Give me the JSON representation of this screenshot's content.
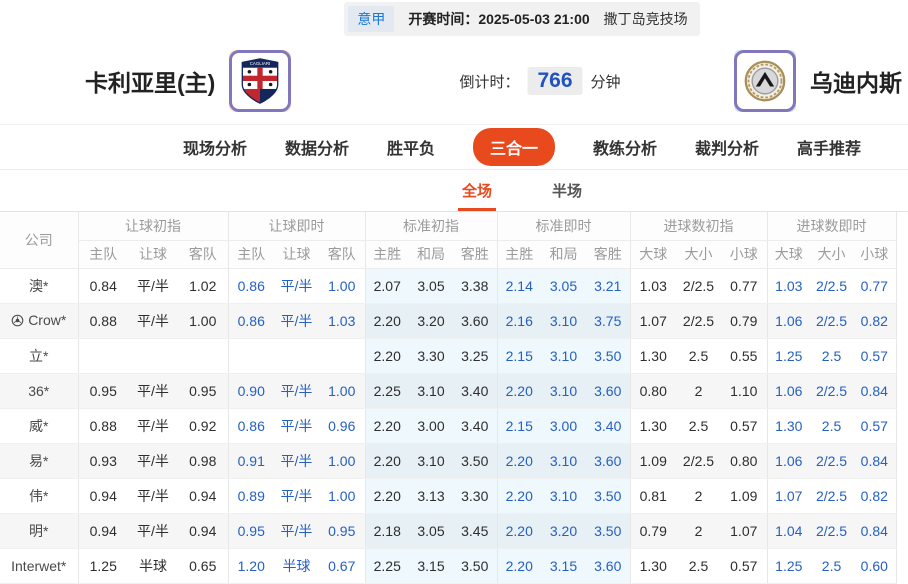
{
  "top_bar": {
    "league": "意甲",
    "kickoff_label": "开赛时间：",
    "kickoff_time": "2025-05-03 21:00",
    "venue": "撒丁岛竞技场"
  },
  "match_header": {
    "home_team": "卡利亚里(主)",
    "away_team": "乌迪内斯",
    "home_logo_icon": "cagliari-crest-icon",
    "away_logo_icon": "udinese-crest-icon",
    "countdown_label": "倒计时：",
    "countdown_value": "766",
    "countdown_unit": "分钟"
  },
  "nav": {
    "items": [
      {
        "label": "现场分析",
        "active": false
      },
      {
        "label": "数据分析",
        "active": false
      },
      {
        "label": "胜平负",
        "active": false
      },
      {
        "label": "三合一",
        "active": true
      },
      {
        "label": "教练分析",
        "active": false
      },
      {
        "label": "裁判分析",
        "active": false
      },
      {
        "label": "高手推荐",
        "active": false
      }
    ]
  },
  "period_tabs": [
    {
      "label": "全场",
      "active": true
    },
    {
      "label": "半场",
      "active": false
    }
  ],
  "odds_table": {
    "company_header": "公司",
    "groups": [
      {
        "label": "让球初指",
        "cols": [
          "主队",
          "让球",
          "客队"
        ],
        "live": false,
        "tint": false
      },
      {
        "label": "让球即时",
        "cols": [
          "主队",
          "让球",
          "客队"
        ],
        "live": true,
        "tint": false
      },
      {
        "label": "标准初指",
        "cols": [
          "主胜",
          "和局",
          "客胜"
        ],
        "live": false,
        "tint": true
      },
      {
        "label": "标准即时",
        "cols": [
          "主胜",
          "和局",
          "客胜"
        ],
        "live": true,
        "tint": true
      },
      {
        "label": "进球数初指",
        "cols": [
          "大球",
          "大小",
          "小球"
        ],
        "live": false,
        "tint": false
      },
      {
        "label": "进球数即时",
        "cols": [
          "大球",
          "大小",
          "小球"
        ],
        "live": true,
        "tint": false
      }
    ],
    "rows": [
      {
        "company": "澳*",
        "icon": false,
        "cells": [
          [
            "0.84",
            "平/半",
            "1.02"
          ],
          [
            "0.86",
            "平/半",
            "1.00"
          ],
          [
            "2.07",
            "3.05",
            "3.38"
          ],
          [
            "2.14",
            "3.05",
            "3.21"
          ],
          [
            "1.03",
            "2/2.5",
            "0.77"
          ],
          [
            "1.03",
            "2/2.5",
            "0.77"
          ]
        ]
      },
      {
        "company": "Crow*",
        "icon": true,
        "cells": [
          [
            "0.88",
            "平/半",
            "1.00"
          ],
          [
            "0.86",
            "平/半",
            "1.03"
          ],
          [
            "2.20",
            "3.20",
            "3.60"
          ],
          [
            "2.16",
            "3.10",
            "3.75"
          ],
          [
            "1.07",
            "2/2.5",
            "0.79"
          ],
          [
            "1.06",
            "2/2.5",
            "0.82"
          ]
        ]
      },
      {
        "company": "立*",
        "icon": false,
        "cells": [
          [
            "",
            "",
            ""
          ],
          [
            "",
            "",
            ""
          ],
          [
            "2.20",
            "3.30",
            "3.25"
          ],
          [
            "2.15",
            "3.10",
            "3.50"
          ],
          [
            "1.30",
            "2.5",
            "0.55"
          ],
          [
            "1.25",
            "2.5",
            "0.57"
          ]
        ]
      },
      {
        "company": "36*",
        "icon": false,
        "cells": [
          [
            "0.95",
            "平/半",
            "0.95"
          ],
          [
            "0.90",
            "平/半",
            "1.00"
          ],
          [
            "2.25",
            "3.10",
            "3.40"
          ],
          [
            "2.20",
            "3.10",
            "3.60"
          ],
          [
            "0.80",
            "2",
            "1.10"
          ],
          [
            "1.06",
            "2/2.5",
            "0.84"
          ]
        ]
      },
      {
        "company": "威*",
        "icon": false,
        "cells": [
          [
            "0.88",
            "平/半",
            "0.92"
          ],
          [
            "0.86",
            "平/半",
            "0.96"
          ],
          [
            "2.20",
            "3.00",
            "3.40"
          ],
          [
            "2.15",
            "3.00",
            "3.40"
          ],
          [
            "1.30",
            "2.5",
            "0.57"
          ],
          [
            "1.30",
            "2.5",
            "0.57"
          ]
        ]
      },
      {
        "company": "易*",
        "icon": false,
        "cells": [
          [
            "0.93",
            "平/半",
            "0.98"
          ],
          [
            "0.91",
            "平/半",
            "1.00"
          ],
          [
            "2.20",
            "3.10",
            "3.50"
          ],
          [
            "2.20",
            "3.10",
            "3.60"
          ],
          [
            "1.09",
            "2/2.5",
            "0.80"
          ],
          [
            "1.06",
            "2/2.5",
            "0.84"
          ]
        ]
      },
      {
        "company": "伟*",
        "icon": false,
        "cells": [
          [
            "0.94",
            "平/半",
            "0.94"
          ],
          [
            "0.89",
            "平/半",
            "1.00"
          ],
          [
            "2.20",
            "3.13",
            "3.30"
          ],
          [
            "2.20",
            "3.10",
            "3.50"
          ],
          [
            "0.81",
            "2",
            "1.09"
          ],
          [
            "1.07",
            "2/2.5",
            "0.82"
          ]
        ]
      },
      {
        "company": "明*",
        "icon": false,
        "cells": [
          [
            "0.94",
            "平/半",
            "0.94"
          ],
          [
            "0.95",
            "平/半",
            "0.95"
          ],
          [
            "2.18",
            "3.05",
            "3.45"
          ],
          [
            "2.20",
            "3.20",
            "3.50"
          ],
          [
            "0.79",
            "2",
            "1.07"
          ],
          [
            "1.04",
            "2/2.5",
            "0.84"
          ]
        ]
      },
      {
        "company": "Interwet*",
        "icon": false,
        "cells": [
          [
            "1.25",
            "半球",
            "0.65"
          ],
          [
            "1.20",
            "半球",
            "0.67"
          ],
          [
            "2.25",
            "3.15",
            "3.50"
          ],
          [
            "2.20",
            "3.15",
            "3.60"
          ],
          [
            "1.30",
            "2.5",
            "0.57"
          ],
          [
            "1.25",
            "2.5",
            "0.60"
          ]
        ]
      }
    ]
  },
  "colors": {
    "accent_red": "#e8491d",
    "live_blue": "#2560c2",
    "countdown_blue": "#2053c0",
    "league_blue": "#1b78d2",
    "standard_tint": "#eff9fc"
  }
}
